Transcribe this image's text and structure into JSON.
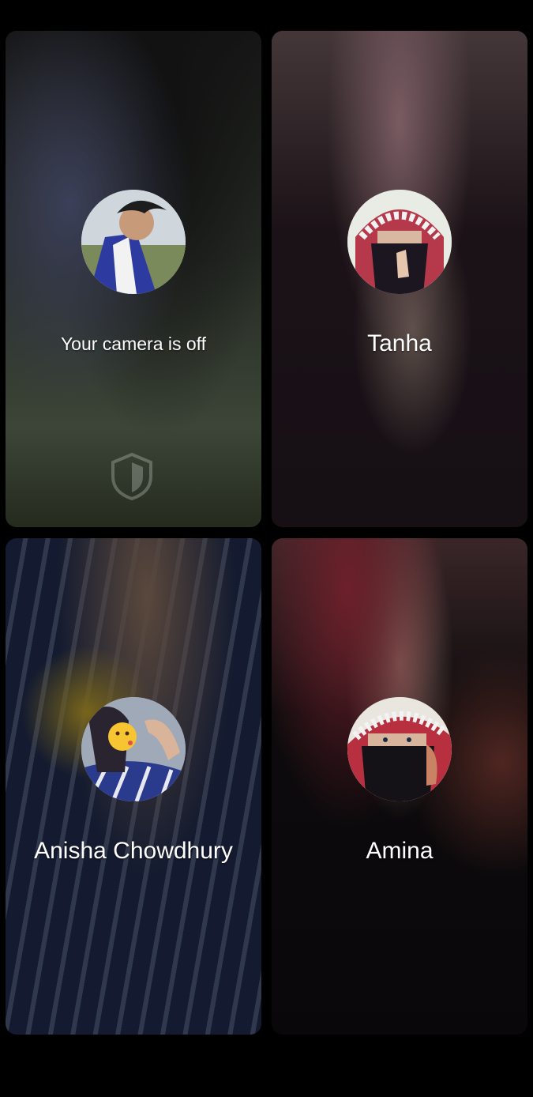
{
  "tiles": [
    {
      "id": "self",
      "label": "Your camera is off",
      "avatar": "male-profile-avatar",
      "background_color": "#3b3f3a"
    },
    {
      "id": "tanha",
      "label": "Tanha",
      "avatar": "niqab-keffiyeh-avatar",
      "background_color": "#4a3a40"
    },
    {
      "id": "anisha",
      "label": "Anisha Chowdhury",
      "avatar": "emoji-face-avatar",
      "background_color": "#2b2a32"
    },
    {
      "id": "amina",
      "label": "Amina",
      "avatar": "red-keffiyeh-avatar",
      "background_color": "#3a2326"
    }
  ],
  "icons": {
    "shield": "shield-icon"
  }
}
